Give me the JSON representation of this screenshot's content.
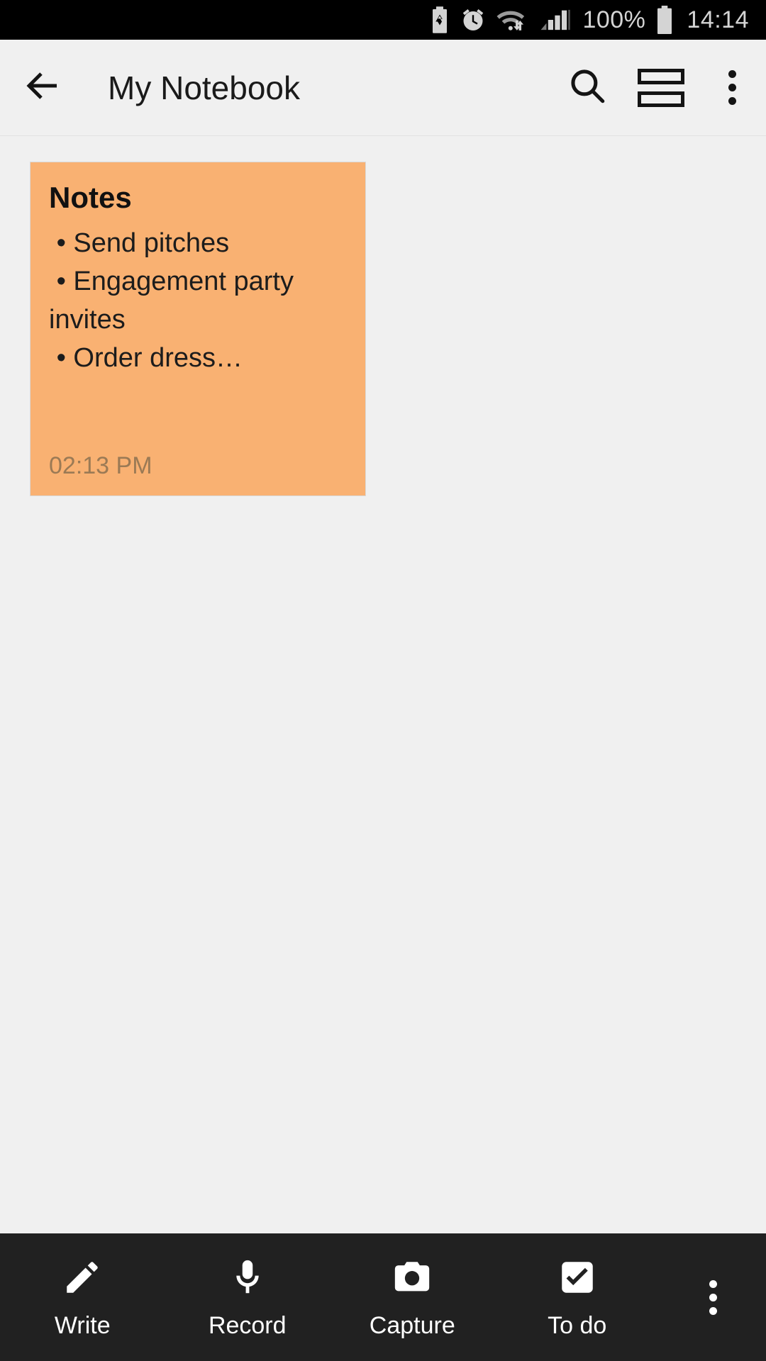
{
  "status_bar": {
    "battery_percent": "100%",
    "time": "14:14",
    "icons": [
      "battery-saver-icon",
      "alarm-clock-icon",
      "wifi-data-transfer-icon",
      "cellular-signal-icon",
      "battery-full-icon"
    ]
  },
  "app_bar": {
    "back_label": "back-arrow",
    "title": "My Notebook",
    "search_label": "search-icon",
    "view_toggle_label": "list-view-icon",
    "overflow_label": "more-options-icon"
  },
  "notes": [
    {
      "title": "Notes",
      "body": " • Send pitches\n • Engagement party invites\n • Order dress…",
      "time": "02:13 PM",
      "color": "#f9b172"
    }
  ],
  "toolbar": {
    "items": [
      {
        "label": "Write",
        "icon": "pencil-icon"
      },
      {
        "label": "Record",
        "icon": "microphone-icon"
      },
      {
        "label": "Capture",
        "icon": "camera-icon"
      },
      {
        "label": "To do",
        "icon": "checkbox-checked-icon"
      }
    ],
    "overflow_label": "more-options-icon"
  },
  "colors": {
    "status_bar_bg": "#000000",
    "app_bar_bg": "#f0f0f0",
    "content_bg": "#efefef",
    "toolbar_bg": "#212121",
    "note_card": "#f9b172",
    "note_time_text": "#9b7a55"
  }
}
